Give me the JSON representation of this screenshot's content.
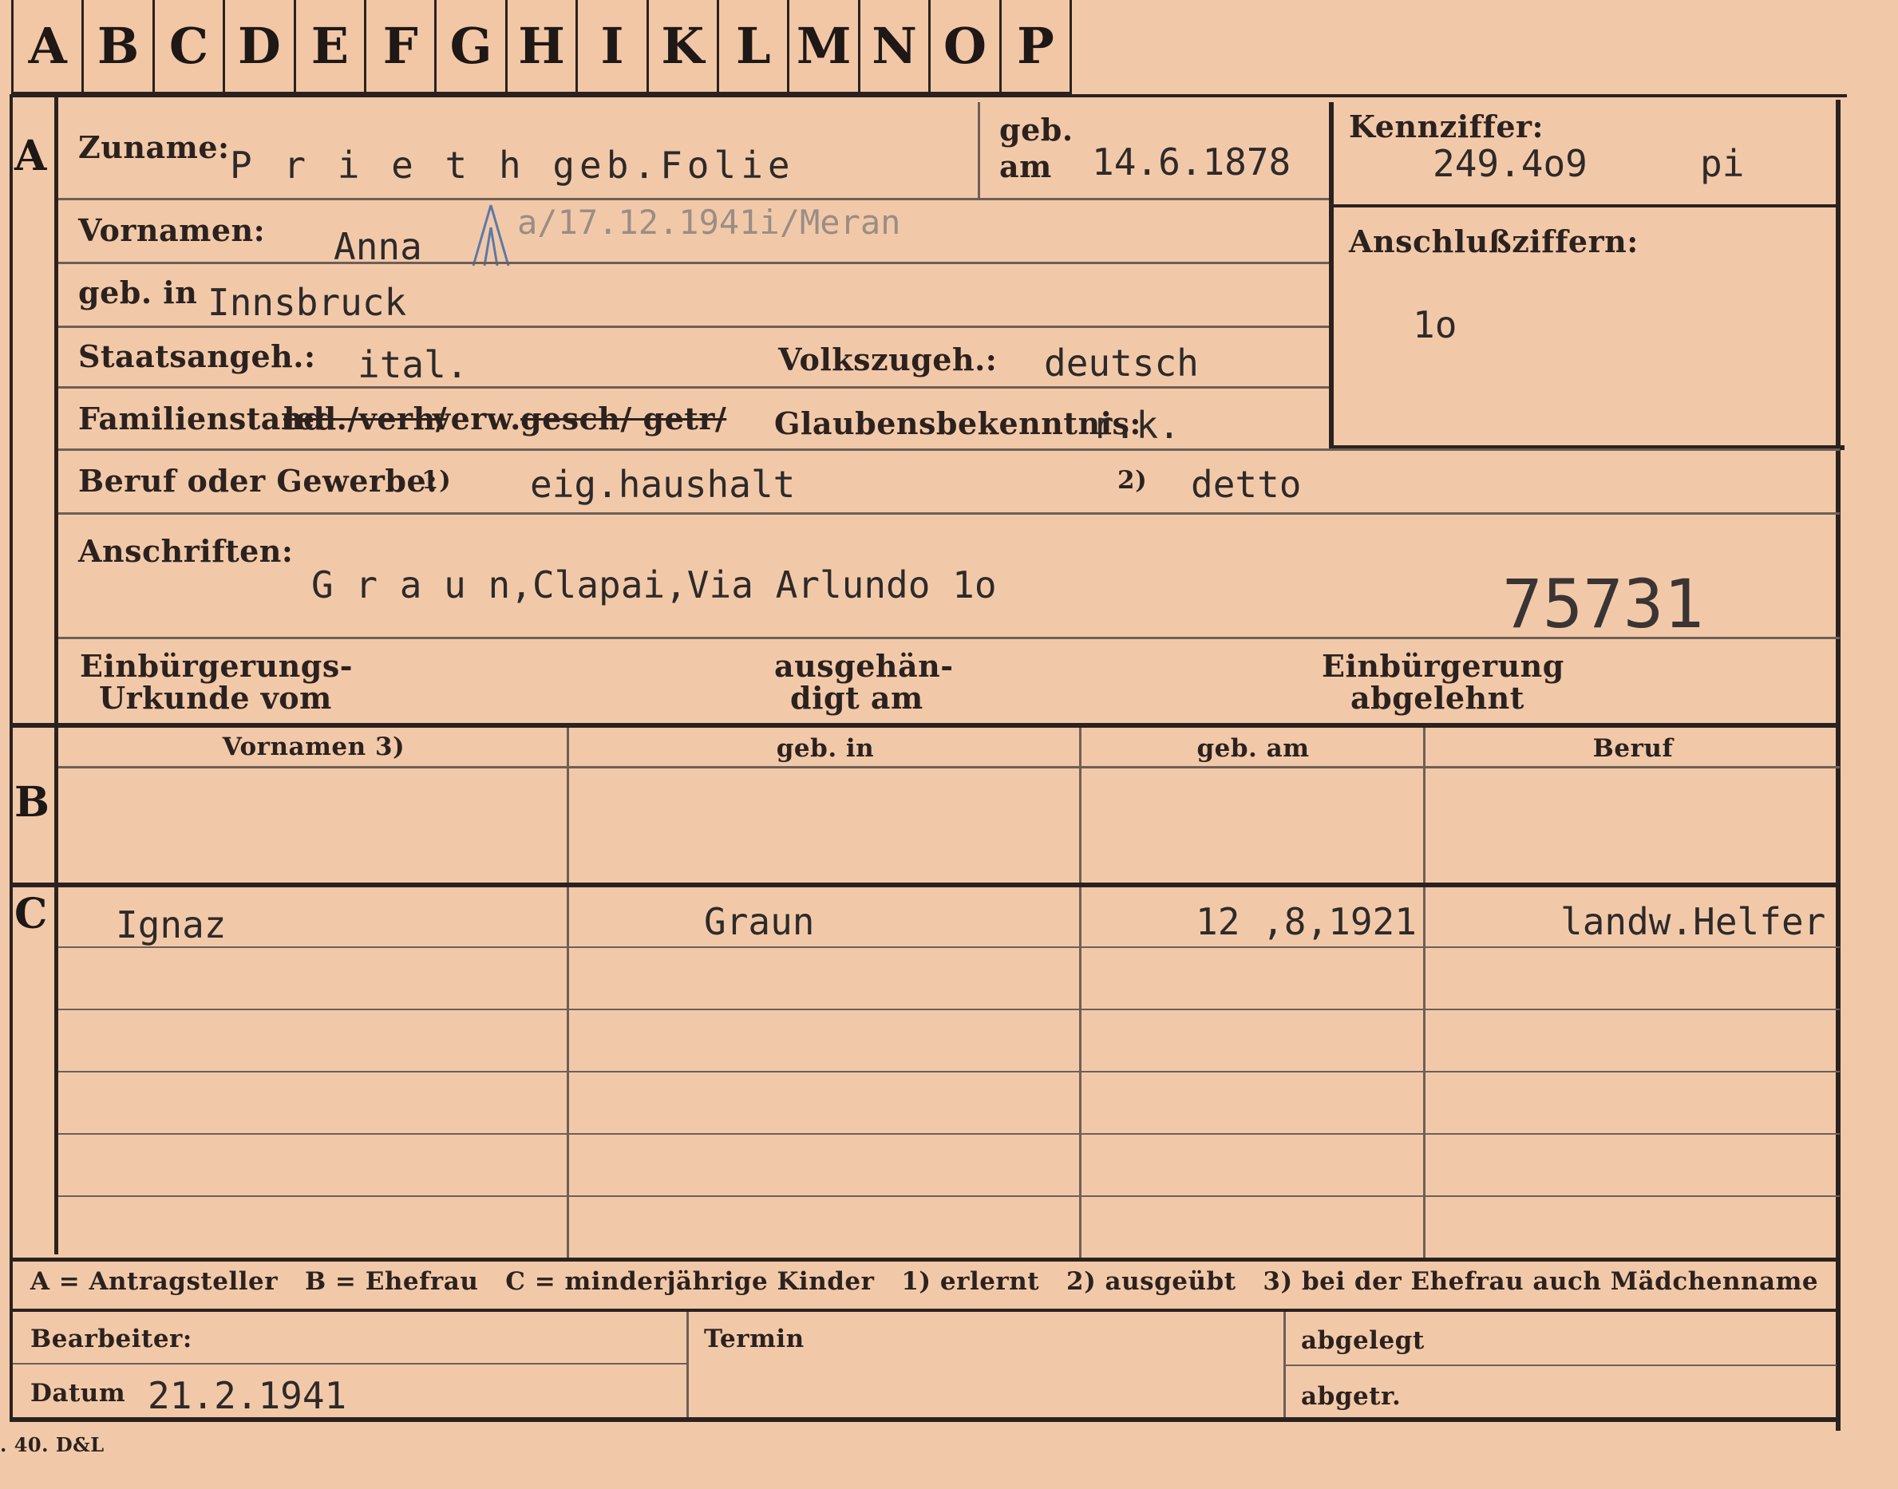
{
  "tabs": [
    "A",
    "B",
    "C",
    "D",
    "E",
    "F",
    "G",
    "H",
    "I",
    "K",
    "L",
    "M",
    "N",
    "O",
    "P"
  ],
  "sections": {
    "a": "A",
    "b": "B",
    "c": "C"
  },
  "applicant": {
    "surname_label": "Zuname:",
    "surname": "P r i e t h  geb.Folie",
    "born_on_label": "geb.",
    "born_on_label2": "am",
    "born_on": "14.6.1878",
    "code_label": "Kennziffer:",
    "code": "249.4o9",
    "code_suffix": "pi",
    "firstname_label": "Vornamen:",
    "firstname": "Anna",
    "death_note": "a/17.12.1941i/Meran",
    "birthplace_label": "geb. in",
    "birthplace": "Innsbruck",
    "linked_label": "Anschlußziffern:",
    "linked": "1o",
    "citizenship_label": "Staatsangeh.:",
    "citizenship": "ital.",
    "ethnicity_label": "Volkszugeh.:",
    "ethnicity": "deutsch",
    "marital_label": "Familienstand:",
    "marital_struck_1": "led./verh/",
    "marital_kept": "verw.",
    "marital_struck_2": "gesch/ getr/",
    "religion_label": "Glaubensbekenntnis:",
    "religion": "r.k.",
    "occupation_label": "Beruf oder Gewerbe:",
    "occ_note_1": "1)",
    "occupation_learned": "eig.haushalt",
    "occ_note_2": "2)",
    "occupation_practiced": "detto",
    "address_label": "Anschriften:",
    "address": "G r a u n,Clapai,Via Arlundo 1o",
    "file_number": "75731",
    "naturalization_label_1": "Einbürgerungs-",
    "naturalization_label_2": "Urkunde vom",
    "handed_label_1": "ausgehän-",
    "handed_label_2": "digt am",
    "refused_label_1": "Einbürgerung",
    "refused_label_2": "abgelehnt"
  },
  "table": {
    "headers": [
      "Vornamen 3)",
      "geb. in",
      "geb. am",
      "Beruf"
    ],
    "children": [
      {
        "name": "Ignaz",
        "place": "Graun",
        "date": "12 ,8,1921",
        "occupation": "landw.Helfer"
      }
    ]
  },
  "legend": "A = Antragsteller   B = Ehefrau   C = minderjährige Kinder   1) erlernt   2) ausgeübt   3) bei der Ehefrau auch Mädchenname",
  "footer": {
    "clerk_label": "Bearbeiter:",
    "date_label": "Datum",
    "date": "21.2.1941",
    "deadline_label": "Termin",
    "filed_label": "abgelegt",
    "removed_label": "abgetr.",
    "print_code": ". 40. D&L"
  }
}
